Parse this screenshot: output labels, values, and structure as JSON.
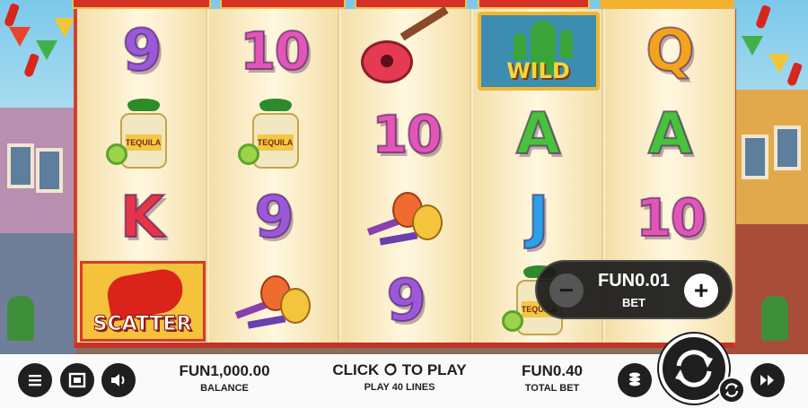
{
  "reels": {
    "reel1": [
      "9",
      "tequila",
      "K",
      "scatter"
    ],
    "reel2": [
      "10",
      "tequila",
      "9",
      "maracas"
    ],
    "reel3": [
      "guitar",
      "10",
      "maracas",
      "9"
    ],
    "reel4": [
      "wild",
      "A",
      "J",
      "tequila"
    ],
    "reel5": [
      "Q",
      "A",
      "10",
      "hidden"
    ]
  },
  "symbols": {
    "wild_label": "WILD",
    "scatter_label": "SCATTER",
    "tequila_label": "TEQUILA",
    "r1_top": "9",
    "r1_mid": "K",
    "r2_top": "10",
    "r2_mid": "9",
    "r3_mid": "10",
    "r3_bot": "9",
    "r4_mid1": "A",
    "r4_mid2": "J",
    "r5_top": "Q",
    "r5_mid1": "A",
    "r5_mid2": "10"
  },
  "bet_panel": {
    "value": "FUN0.01",
    "label": "BET",
    "minus": "−",
    "plus": "+"
  },
  "bottom_bar": {
    "balance_value": "FUN1,000.00",
    "balance_label": "BALANCE",
    "click_text": "CLICK",
    "to_play_text": "TO PLAY",
    "lines_text": "PLAY 40 LINES",
    "total_bet_value": "FUN0.40",
    "total_bet_label": "TOTAL BET"
  },
  "icons": {
    "menu": "menu-icon",
    "fullscreen": "fullscreen-icon",
    "sound": "speaker-icon",
    "coins": "coins-icon",
    "spin": "spin-icon",
    "autospin": "autospin-icon",
    "turbo": "fast-forward-icon"
  },
  "colors": {
    "reel_frame": "#d4402e",
    "bet_panel_bg": "#191919",
    "bottom_bar_bg": "#fafafa"
  }
}
